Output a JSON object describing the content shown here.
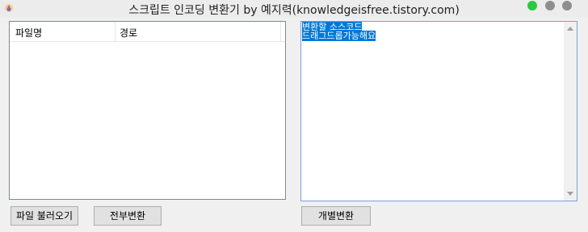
{
  "window": {
    "title": "스크립트 인코딩 변환기 by 예지력(knowledgeisfree.tistory.com)",
    "traffic_light_colors": [
      "#2ac940",
      "#8e8e8e",
      "#8e8e8e"
    ]
  },
  "file_list": {
    "columns": [
      "파일명",
      "경로"
    ],
    "rows": []
  },
  "editor": {
    "lines": [
      "변환할 소스코드",
      "드래그드롭가능해요"
    ]
  },
  "buttons": {
    "load_files": "파일 불러오기",
    "convert_all": "전부변환",
    "convert_single": "개별변환"
  }
}
